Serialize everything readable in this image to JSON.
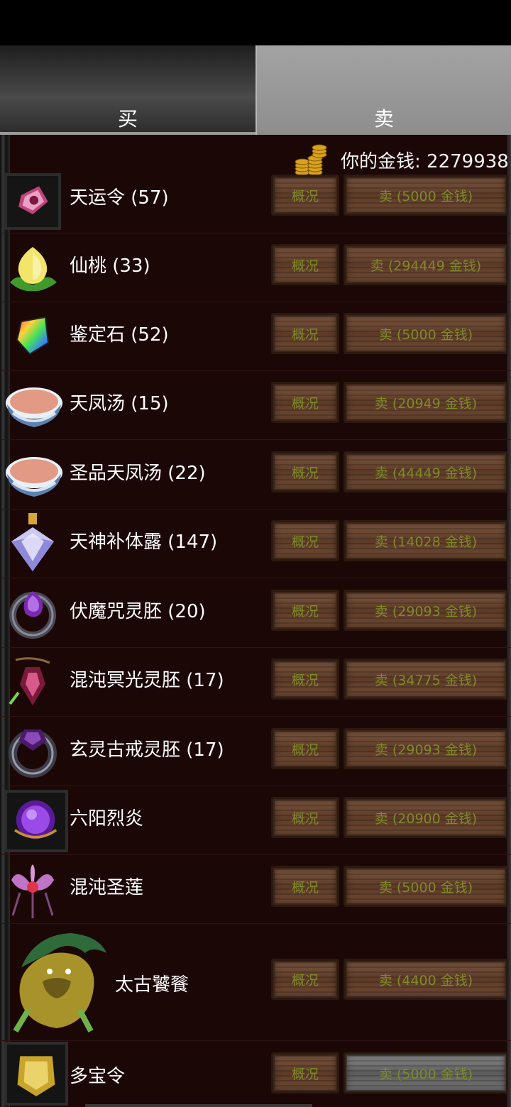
{
  "tabs": {
    "buy": "买",
    "sell": "卖"
  },
  "money": {
    "label": "你的金钱: 2279938"
  },
  "colors": {
    "sell_text": "#7f8a2a",
    "panel_bg": "#1c0707",
    "tab_active": "#8e8e8e"
  },
  "items": [
    {
      "name": "天运令 (57)",
      "icon": "token-charm-icon",
      "detail": "概况",
      "sell": "卖 (5000 金钱)"
    },
    {
      "name": "仙桃 (33)",
      "icon": "peach-icon",
      "detail": "概况",
      "sell": "卖 (294449 金钱)"
    },
    {
      "name": "鉴定石 (52)",
      "icon": "rainbow-gem-icon",
      "detail": "概况",
      "sell": "卖 (5000 金钱)"
    },
    {
      "name": "天凤汤 (15)",
      "icon": "soup-bowl-icon",
      "detail": "概况",
      "sell": "卖 (20949 金钱)"
    },
    {
      "name": "圣品天凤汤 (22)",
      "icon": "soup-bowl-icon",
      "detail": "概况",
      "sell": "卖 (44449 金钱)"
    },
    {
      "name": "天神补体露 (147)",
      "icon": "potion-bottle-icon",
      "detail": "概况",
      "sell": "卖 (14028 金钱)"
    },
    {
      "name": "伏魔咒灵胚 (20)",
      "icon": "purple-ring-icon",
      "detail": "概况",
      "sell": "卖 (29093 金钱)"
    },
    {
      "name": "混沌冥光灵胚 (17)",
      "icon": "pendant-icon",
      "detail": "概况",
      "sell": "卖 (34775 金钱)"
    },
    {
      "name": "玄灵古戒灵胚 (17)",
      "icon": "dark-ring-icon",
      "detail": "概况",
      "sell": "卖 (29093 金钱)"
    },
    {
      "name": "六阳烈炎",
      "icon": "purple-orb-icon",
      "detail": "概况",
      "sell": "卖 (20900 金钱)"
    },
    {
      "name": "混沌圣莲",
      "icon": "lotus-flower-icon",
      "detail": "概况",
      "sell": "卖 (5000 金钱)"
    },
    {
      "name": "太古饕餮",
      "icon": "beast-icon",
      "detail": "概况",
      "sell": "卖 (4400 金钱)"
    },
    {
      "name": "多宝令",
      "icon": "gold-token-icon",
      "detail": "概况",
      "sell": "卖 (5000 金钱)"
    }
  ]
}
